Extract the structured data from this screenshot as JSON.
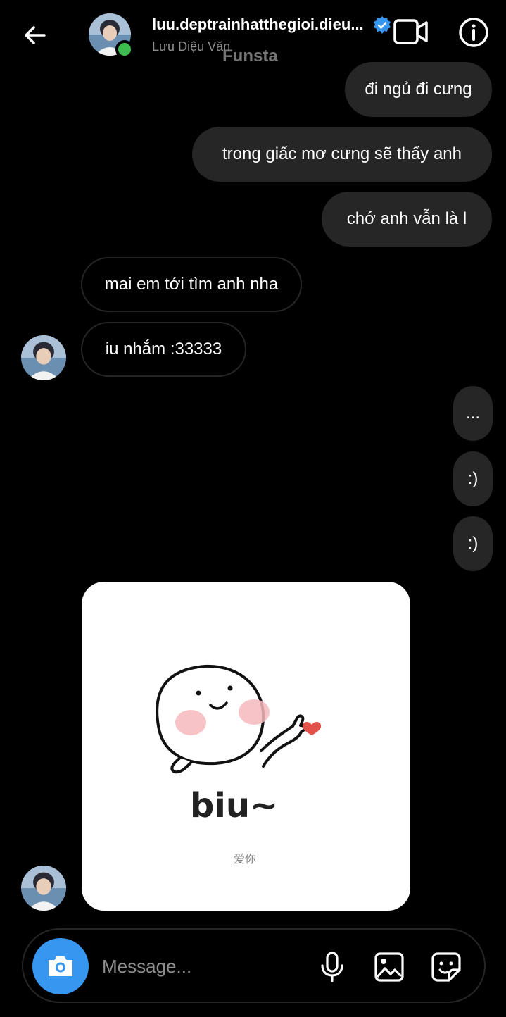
{
  "header": {
    "username": "luu.deptrainhatthegioi.dieu...",
    "fullname": "Lưu Diệu Văn",
    "watermark": "Funsta"
  },
  "messages": [
    {
      "side": "sent",
      "text": "đi ngủ đi cưng"
    },
    {
      "side": "sent",
      "text": "trong giấc mơ cưng sẽ thấy anh"
    },
    {
      "side": "sent",
      "text": "chớ anh vẫn là  l"
    },
    {
      "side": "received",
      "text": "mai em tới tìm anh nha"
    },
    {
      "side": "received",
      "text": "iu nhắm :33333"
    },
    {
      "side": "sent",
      "text": "..."
    },
    {
      "side": "sent",
      "text": ":)"
    },
    {
      "side": "sent",
      "text": ":)"
    }
  ],
  "sticker": {
    "text": "biu~",
    "subtext": "爱你"
  },
  "composer": {
    "placeholder": "Message..."
  },
  "colors": {
    "background": "#000000",
    "sent_bubble": "#262626",
    "accent": "#3797f0",
    "online": "#3ebd4f",
    "verified": "#3797f0"
  },
  "icons": [
    "back-arrow-icon",
    "verified-badge-icon",
    "video-call-icon",
    "info-icon",
    "camera-icon",
    "microphone-icon",
    "gallery-icon",
    "sticker-icon"
  ]
}
